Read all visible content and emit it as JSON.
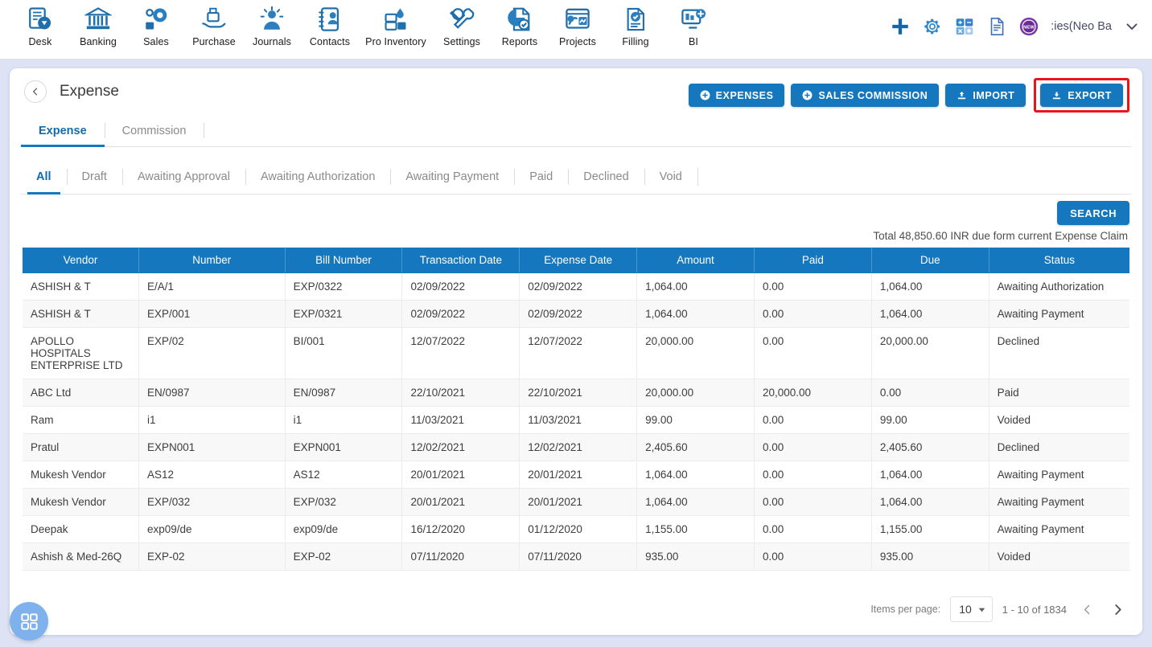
{
  "topnav": {
    "items": [
      {
        "label": "Desk",
        "icon": "desk-icon"
      },
      {
        "label": "Banking",
        "icon": "bank-icon"
      },
      {
        "label": "Sales",
        "icon": "sales-icon"
      },
      {
        "label": "Purchase",
        "icon": "purchase-icon"
      },
      {
        "label": "Journals",
        "icon": "journals-icon"
      },
      {
        "label": "Contacts",
        "icon": "contacts-icon"
      },
      {
        "label": "Pro Inventory",
        "icon": "inventory-icon"
      },
      {
        "label": "Settings",
        "icon": "settings-icon"
      },
      {
        "label": "Reports",
        "icon": "reports-icon"
      },
      {
        "label": "Projects",
        "icon": "projects-icon"
      },
      {
        "label": "Filling",
        "icon": "filling-icon"
      },
      {
        "label": "BI",
        "icon": "bi-icon"
      }
    ],
    "right": {
      "add_icon": "plus-icon",
      "settings_icon": "gear-icon",
      "calculator_icon": "calculator-icon",
      "notes_icon": "document-icon",
      "new_badge_icon": "new-badge-icon",
      "new_badge_text": "NEW",
      "account_name": ":ies(Neo Ba",
      "caret_icon": "chevron-down-icon"
    }
  },
  "page": {
    "back_icon": "chevron-left-icon",
    "title": "Expense",
    "actions": [
      {
        "label": "EXPENSES",
        "icon": "plus-circle-icon",
        "highlighted": false
      },
      {
        "label": "SALES COMMISSION",
        "icon": "plus-circle-icon",
        "highlighted": false
      },
      {
        "label": "IMPORT",
        "icon": "upload-icon",
        "highlighted": false
      },
      {
        "label": "EXPORT",
        "icon": "download-icon",
        "highlighted": true
      }
    ],
    "tabs": [
      {
        "label": "Expense",
        "active": true
      },
      {
        "label": "Commission",
        "active": false
      }
    ],
    "filters": [
      {
        "label": "All",
        "active": true
      },
      {
        "label": "Draft",
        "active": false
      },
      {
        "label": "Awaiting Approval",
        "active": false
      },
      {
        "label": "Awaiting Authorization",
        "active": false
      },
      {
        "label": "Awaiting Payment",
        "active": false
      },
      {
        "label": "Paid",
        "active": false
      },
      {
        "label": "Declined",
        "active": false
      },
      {
        "label": "Void",
        "active": false
      }
    ],
    "search_label": "SEARCH",
    "total_note": "Total 48,850.60 INR due form current Expense Claim"
  },
  "table": {
    "columns": [
      "Vendor",
      "Number",
      "Bill Number",
      "Transaction Date",
      "Expense Date",
      "Amount",
      "Paid",
      "Due",
      "Status"
    ],
    "rows": [
      {
        "vendor": "ASHISH & T",
        "number": "E/A/1",
        "bill_number": "EXP/0322",
        "transaction_date": "02/09/2022",
        "expense_date": "02/09/2022",
        "amount": "1,064.00",
        "paid": "0.00",
        "due": "1,064.00",
        "status": "Awaiting Authorization"
      },
      {
        "vendor": "ASHISH & T",
        "number": "EXP/001",
        "bill_number": "EXP/0321",
        "transaction_date": "02/09/2022",
        "expense_date": "02/09/2022",
        "amount": "1,064.00",
        "paid": "0.00",
        "due": "1,064.00",
        "status": "Awaiting Payment"
      },
      {
        "vendor": "APOLLO HOSPITALS ENTERPRISE LTD",
        "number": "EXP/02",
        "bill_number": "BI/001",
        "transaction_date": "12/07/2022",
        "expense_date": "12/07/2022",
        "amount": "20,000.00",
        "paid": "0.00",
        "due": "20,000.00",
        "status": "Declined"
      },
      {
        "vendor": "ABC Ltd",
        "number": "EN/0987",
        "bill_number": "EN/0987",
        "transaction_date": "22/10/2021",
        "expense_date": "22/10/2021",
        "amount": "20,000.00",
        "paid": "20,000.00",
        "due": "0.00",
        "status": "Paid"
      },
      {
        "vendor": "Ram",
        "number": "i1",
        "bill_number": "i1",
        "transaction_date": "11/03/2021",
        "expense_date": "11/03/2021",
        "amount": "99.00",
        "paid": "0.00",
        "due": "99.00",
        "status": "Voided"
      },
      {
        "vendor": "Pratul",
        "number": "EXPN001",
        "bill_number": "EXPN001",
        "transaction_date": "12/02/2021",
        "expense_date": "12/02/2021",
        "amount": "2,405.60",
        "paid": "0.00",
        "due": "2,405.60",
        "status": "Declined"
      },
      {
        "vendor": "Mukesh Vendor",
        "number": "AS12",
        "bill_number": "AS12",
        "transaction_date": "20/01/2021",
        "expense_date": "20/01/2021",
        "amount": "1,064.00",
        "paid": "0.00",
        "due": "1,064.00",
        "status": "Awaiting Payment"
      },
      {
        "vendor": "Mukesh Vendor",
        "number": "EXP/032",
        "bill_number": "EXP/032",
        "transaction_date": "20/01/2021",
        "expense_date": "20/01/2021",
        "amount": "1,064.00",
        "paid": "0.00",
        "due": "1,064.00",
        "status": "Awaiting Payment"
      },
      {
        "vendor": "Deepak",
        "number": "exp09/de",
        "bill_number": "exp09/de",
        "transaction_date": "16/12/2020",
        "expense_date": "01/12/2020",
        "amount": "1,155.00",
        "paid": "0.00",
        "due": "1,155.00",
        "status": "Awaiting Payment"
      },
      {
        "vendor": "Ashish & Med-26Q",
        "number": "EXP-02",
        "bill_number": "EXP-02",
        "transaction_date": "07/11/2020",
        "expense_date": "07/11/2020",
        "amount": "935.00",
        "paid": "0.00",
        "due": "935.00",
        "status": "Voided"
      }
    ]
  },
  "paginator": {
    "items_per_page_label": "Items per page:",
    "items_per_page_value": "10",
    "range": "1 - 10 of 1834",
    "prev_icon": "chevron-left-icon",
    "next_icon": "chevron-right-icon"
  },
  "fab": {
    "icon": "grid-apps-icon"
  },
  "colors": {
    "primary": "#1577bd",
    "page_background": "#dde3f5",
    "highlight": "#e8161b",
    "link": "#4a81b8",
    "fab": "#7fb2ec"
  }
}
